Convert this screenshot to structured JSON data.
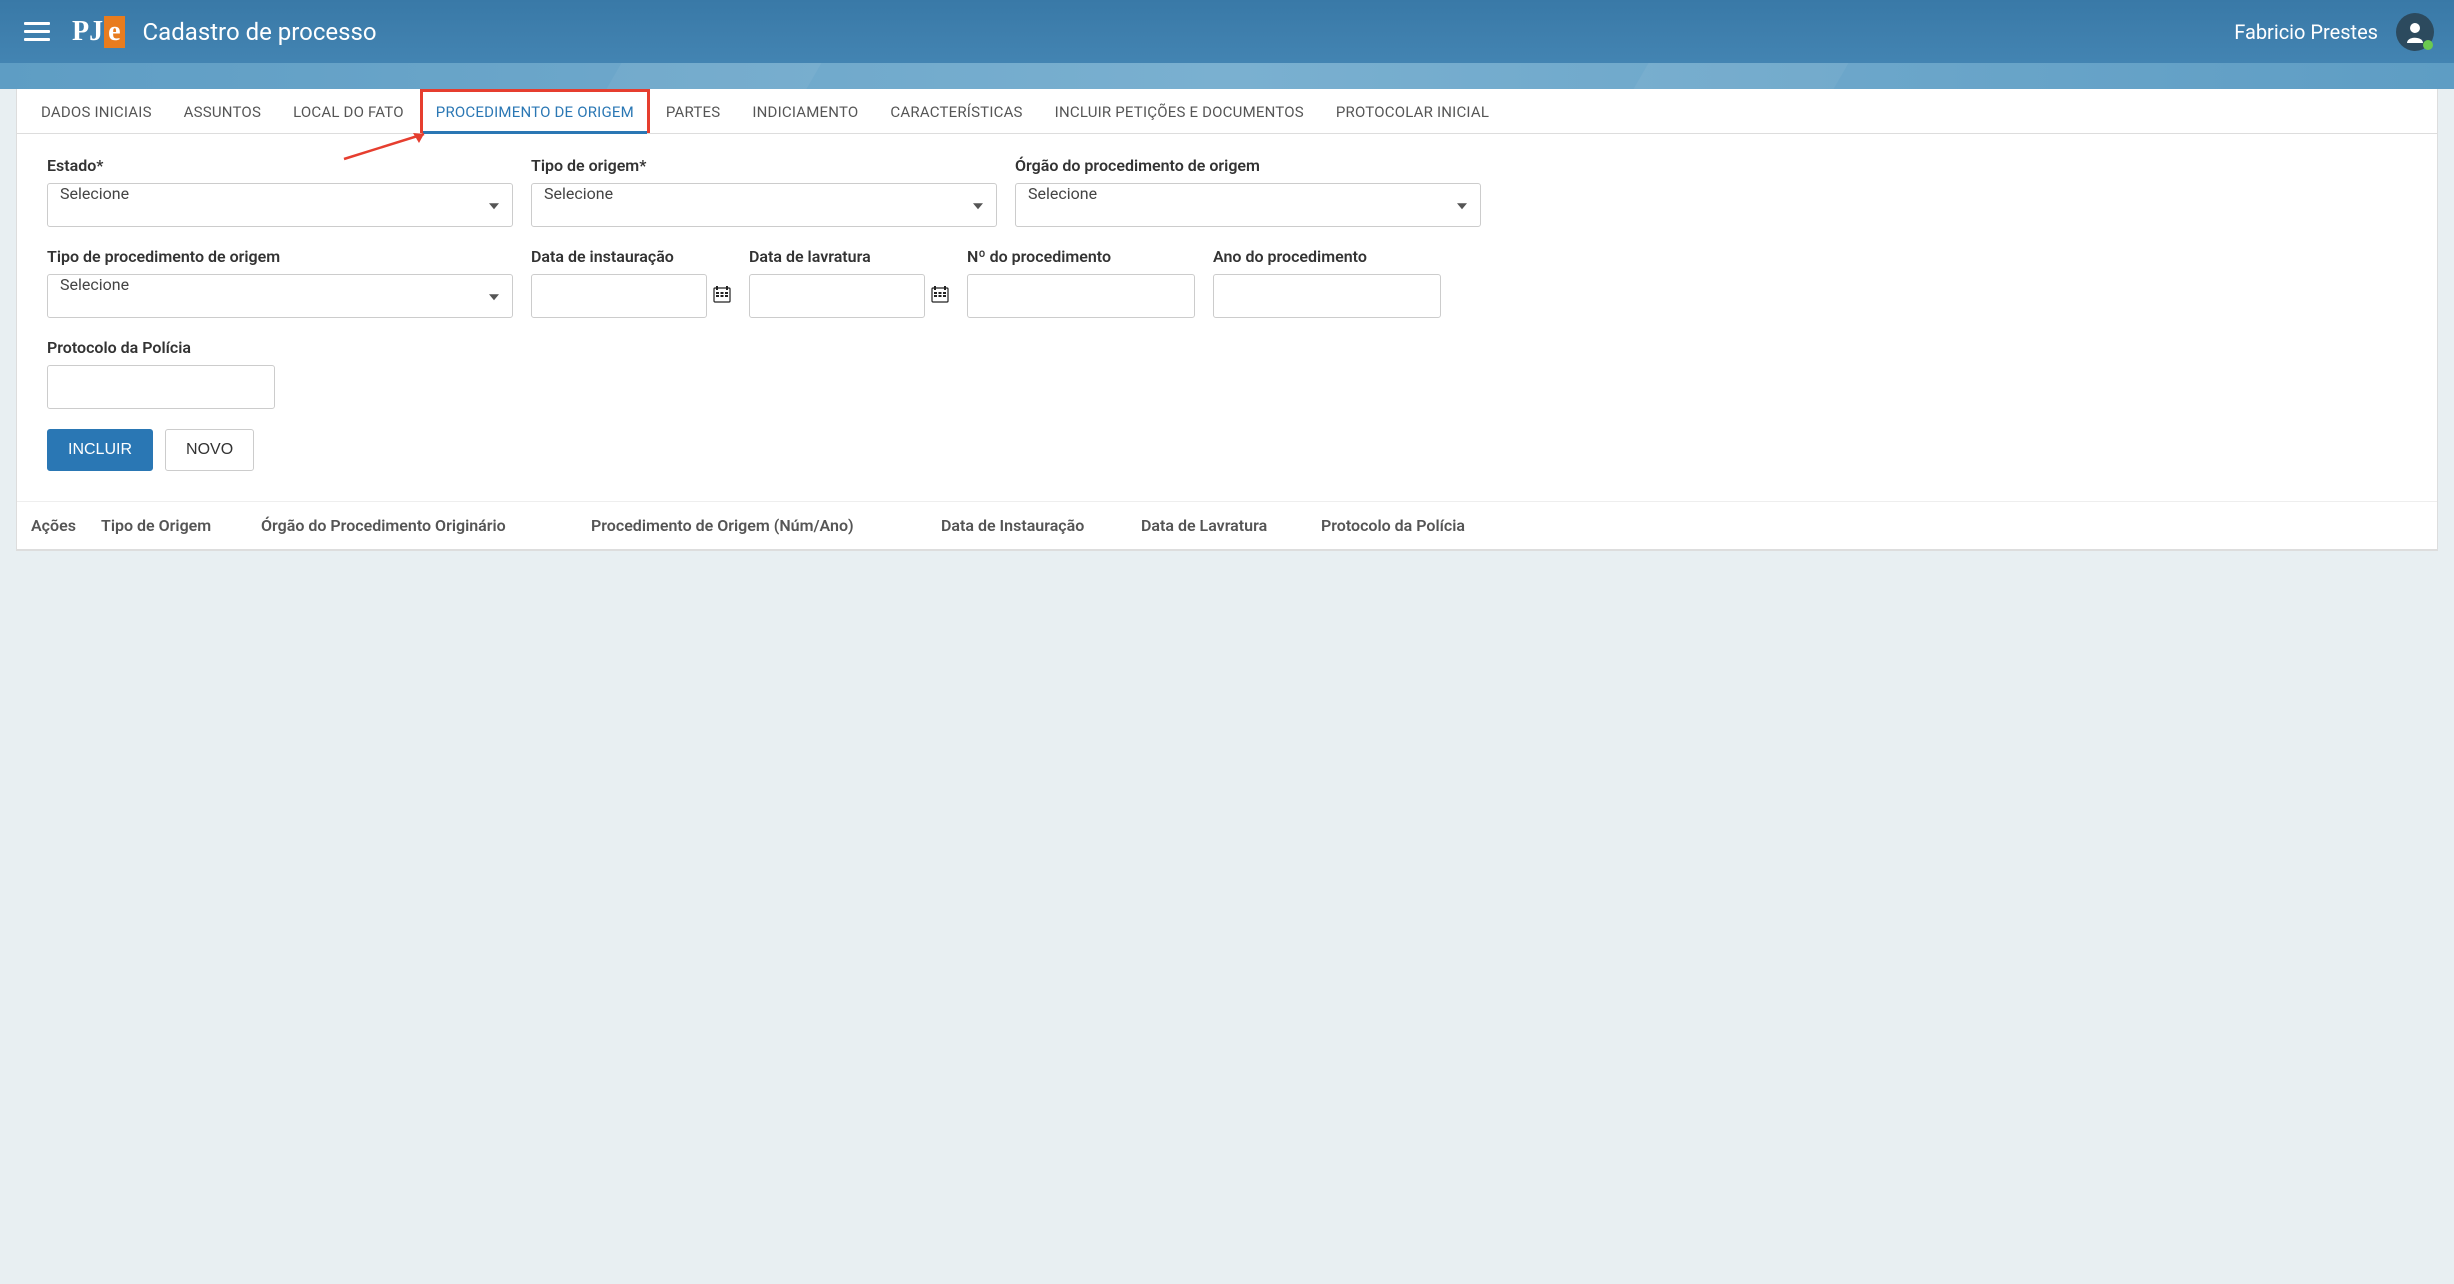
{
  "header": {
    "logo_p": "PJ",
    "logo_e": "e",
    "page_title": "Cadastro de processo",
    "user_name": "Fabricio Prestes"
  },
  "tabs": [
    {
      "label": "DADOS INICIAIS",
      "active": false
    },
    {
      "label": "ASSUNTOS",
      "active": false
    },
    {
      "label": "LOCAL DO FATO",
      "active": false
    },
    {
      "label": "PROCEDIMENTO DE ORIGEM",
      "active": true
    },
    {
      "label": "PARTES",
      "active": false
    },
    {
      "label": "INDICIAMENTO",
      "active": false
    },
    {
      "label": "CARACTERÍSTICAS",
      "active": false
    },
    {
      "label": "INCLUIR PETIÇÕES E DOCUMENTOS",
      "active": false
    },
    {
      "label": "PROTOCOLAR INICIAL",
      "active": false
    }
  ],
  "form": {
    "estado": {
      "label": "Estado*",
      "value": "Selecione"
    },
    "tipo_origem": {
      "label": "Tipo de origem*",
      "value": "Selecione"
    },
    "orgao": {
      "label": "Órgão do procedimento de origem",
      "value": "Selecione"
    },
    "tipo_proc": {
      "label": "Tipo de procedimento de origem",
      "value": "Selecione"
    },
    "data_inst": {
      "label": "Data de instauração",
      "value": ""
    },
    "data_lav": {
      "label": "Data de lavratura",
      "value": ""
    },
    "num_proc": {
      "label": "Nº do procedimento",
      "value": ""
    },
    "ano_proc": {
      "label": "Ano do procedimento",
      "value": ""
    },
    "protocolo": {
      "label": "Protocolo da Polícia",
      "value": ""
    }
  },
  "buttons": {
    "incluir": "INCLUIR",
    "novo": "NOVO"
  },
  "table_headers": {
    "acoes": "Ações",
    "tipo": "Tipo de Origem",
    "orgao": "Órgão do Procedimento Originário",
    "proc": "Procedimento de Origem (Núm/Ano)",
    "inst": "Data de Instauração",
    "lav": "Data de Lavratura",
    "prot": "Protocolo da Polícia"
  }
}
